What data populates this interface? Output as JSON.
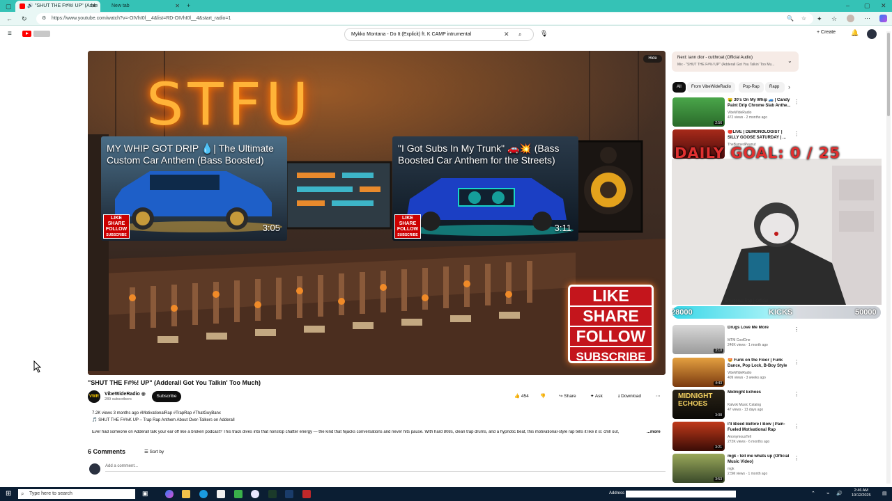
{
  "browser": {
    "tabs": [
      {
        "label": "\"SHUT THE F#%! UP\" (Adde",
        "active": true
      },
      {
        "label": "New tab",
        "active": false
      }
    ],
    "url": "https://www.youtube.com/watch?v=-OIVhI0l__4&list=RD-OIVhI0l__4&start_radio=1"
  },
  "youtube": {
    "search_value": "Mykko Montana - Do It (Explicit) ft. K CAMP intrumental",
    "create_label": "Create",
    "colors": {
      "accent": "#ff0000",
      "subscribe": "#0f0f0f"
    }
  },
  "player": {
    "neon_text": "STFU",
    "hide_label": "Hide",
    "endcards": [
      {
        "title": "MY WHIP GOT DRIP 💧| The Ultimate Custom Car Anthem (Bass Boosted)",
        "duration": "3:05"
      },
      {
        "title": "\"I Got Subs In My Trunk\" 🚗💥 (Bass Boosted Car Anthem for the Streets)",
        "duration": "3:11"
      }
    ],
    "mini_like_lines": [
      "LIKE",
      "SHARE",
      "FOLLOW",
      "SUBSCRIBE"
    ],
    "big_like_lines": [
      "LIKE",
      "SHARE",
      "FOLLOW",
      "SUBSCRIBE"
    ]
  },
  "video": {
    "title": "\"SHUT THE F#%! UP\" (Adderall Got You Talkin' Too Much)",
    "channel_initials": "VWR",
    "channel_name": "VibeWideRadio",
    "subscribers": "289 subscribers",
    "subscribe_label": "Subscribe",
    "likes": "454",
    "share_label": "Share",
    "ask_label": "Ask",
    "download_label": "Download",
    "stats_line": "7.2K views  3 months ago  #MotivationalRap #TrapRap #ThatGuyBanx",
    "desc_line1": "🎵 SHUT THE F#%K UP – Trap Rap Anthem About Over-Talkers on Adderall",
    "desc_line2": "Ever had someone on Adderall talk your ear off like a broken podcast? This track dives into that nonstop chatter energy — the kind that hijacks conversations and never hits pause. With hard 808s, clean trap drums, and a hypnotic beat, this motivational-style rap tells it like it is: chill out,",
    "more_label": "...more",
    "comments_count": "6 Comments",
    "sort_label": "Sort by",
    "add_comment_placeholder": "Add a comment..."
  },
  "sidebar": {
    "next_title": "Next: iann dior - cutthroat (Official Audio)",
    "next_sub": "Mix - \"SHUT THE F#%! UP\" (Adderall Got You Talkin' Too Mu...",
    "chips": [
      "All",
      "From VibeWideRadio",
      "Pop-Rap",
      "Rapp"
    ],
    "recs": [
      {
        "title": "🤑 30's On My Whip 🚙 | Candy Paint Drip  Chrome Slab Anthe...",
        "channel": "VibeWideRadio",
        "meta": "472 views · 2 months ago",
        "duration": "2:56",
        "thumb_color": "#3c8a3a"
      },
      {
        "title": "🔴LIVE | DEMONOLOGIST | SILLY GOOSE SATURDAY | ...",
        "channel": "TheBurnedPeanut",
        "meta": "",
        "duration": "",
        "thumb_color": "#7a1c1c"
      },
      {
        "title": "Drugs Love Me More",
        "channel": "MTM CoolOne",
        "meta": "246K views · 1 month ago",
        "duration": "3:10",
        "thumb_color": "#b9b9b9"
      },
      {
        "title": "🤩 Funk on the Floor | Funk Dance, Pop Lock, B-Boy Style ...",
        "channel": "VibeWideRadio",
        "meta": "409 views · 3 weeks ago",
        "duration": "4:43",
        "thumb_color": "#c77a1e"
      },
      {
        "title": "Midnight Echoes",
        "channel": "Kalvok Music Catalog",
        "meta": "47 views · 13 days ago",
        "duration": "3:08",
        "thumb_color": "#1d1a14"
      },
      {
        "title": "I'll Bleed Before I Bow | Pain-Fueled Motivational Rap",
        "channel": "AnonymousTell",
        "meta": "272K views · 6 months ago",
        "duration": "3:21",
        "thumb_color": "#8a1b12"
      },
      {
        "title": "mgk - tell me whats up (Official Music Video)",
        "channel": "mgk",
        "meta": "2.5M views · 1 month ago",
        "duration": "3:53",
        "thumb_color": "#6e7a4a"
      }
    ]
  },
  "overlay": {
    "goal_text": "DAILY GOAL: 0 / 25",
    "bar_left": "28000",
    "bar_mid": "KICKS",
    "bar_right": "50000",
    "peek_text": "Emotional Rap | Official"
  },
  "taskbar": {
    "search_placeholder": "Type here to search",
    "address_label": "Address",
    "time": "2:46 AM",
    "date": "10/12/2025"
  }
}
